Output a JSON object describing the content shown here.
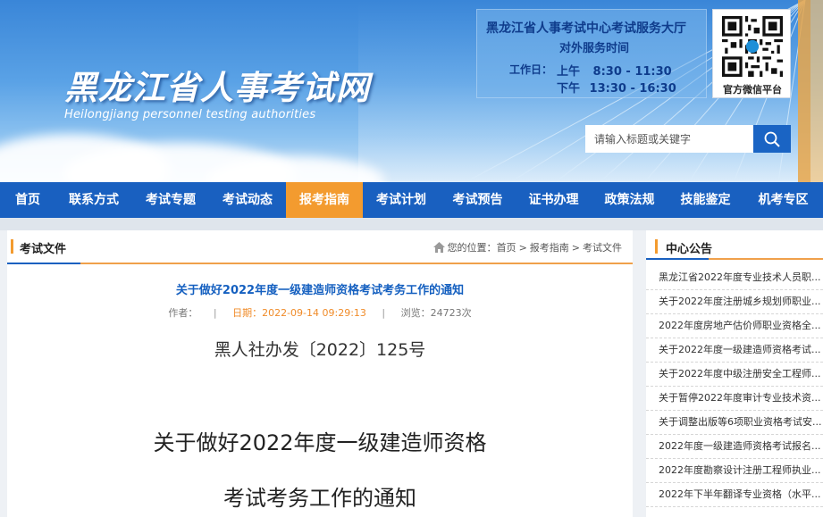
{
  "site": {
    "title": "黑龙江省人事考试网",
    "subtitle": "Heilongjiang personnel testing authorities"
  },
  "service": {
    "title": "黑龙江省人事考试中心考试服务大厅",
    "subtitle": "对外服务时间",
    "worktime_label": "工作日：",
    "morning_label": "上午",
    "morning_time": "8:30 - 11:30",
    "afternoon_label": "下午",
    "afternoon_time": "13:30 - 16:30"
  },
  "qr": {
    "caption": "官方微信平台"
  },
  "search": {
    "placeholder": "请输入标题或关键字",
    "icon": "search-icon"
  },
  "nav": {
    "items": [
      {
        "label": "首页",
        "w": 62
      },
      {
        "label": "联系方式",
        "w": 86
      },
      {
        "label": "考试专题",
        "w": 86
      },
      {
        "label": "考试动态",
        "w": 86
      },
      {
        "label": "报考指南",
        "w": 86
      },
      {
        "label": "考试计划",
        "w": 86
      },
      {
        "label": "考试预告",
        "w": 85
      },
      {
        "label": "证书办理",
        "w": 85
      },
      {
        "label": "政策法规",
        "w": 85
      },
      {
        "label": "技能鉴定",
        "w": 85
      },
      {
        "label": "机考专区",
        "w": 89
      }
    ],
    "active_index": 4,
    "bg_color": "#1960c0",
    "active_color": "#f39b2f"
  },
  "main": {
    "section_title": "考试文件",
    "breadcrumb": {
      "prefix": "您的位置：",
      "home": "首页",
      "sep": ">",
      "level1": "报考指南",
      "level2": "考试文件"
    },
    "article": {
      "title": "关于做好2022年度一级建造师资格考试考务工作的通知",
      "author_label": "作者：",
      "date_label": "日期：2022-09-14 09:29:13",
      "views_label": "浏览：24723次",
      "doc_number": "黑人社办发〔2022〕125号",
      "heading_line1": "关于做好2022年度一级建造师资格",
      "heading_line2": "考试考务工作的通知"
    }
  },
  "side": {
    "title": "中心公告",
    "items": [
      "黑龙江省2022年度专业技术人员职...",
      "关于2022年度注册城乡规划师职业...",
      "2022年度房地产估价师职业资格全...",
      "关于2022年度一级建造师资格考试...",
      "关于2022年度中级注册安全工程师...",
      "关于暂停2022年度审计专业技术资...",
      "关于调整出版等6项职业资格考试安...",
      "2022年度一级建造师资格考试报名...",
      "2022年度勘察设计注册工程师执业...",
      "2022年下半年翻译专业资格（水平..."
    ]
  }
}
